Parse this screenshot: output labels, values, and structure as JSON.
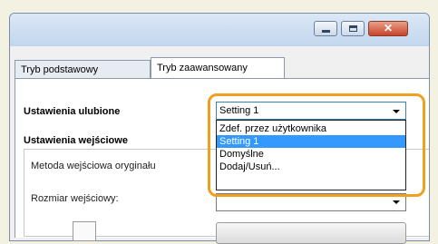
{
  "window": {
    "tabs": [
      {
        "label": "Tryb podstawowy",
        "active": false
      },
      {
        "label": "Tryb zaawansowany",
        "active": true
      }
    ]
  },
  "favorites": {
    "label": "Ustawienia ulubione",
    "selected": "Setting 1",
    "options": [
      "Zdef. przez użytkownika",
      "Setting 1",
      "Domyślne",
      "Dodaj/Usuń..."
    ],
    "highlighted_index": 1
  },
  "input_settings": {
    "label": "Ustawienia wejściowe",
    "method_label": "Metoda wejściowa oryginału",
    "size_label": "Rozmiar wejściowy:"
  },
  "colors": {
    "highlight_border": "#f0a020",
    "selection": "#3399ff"
  }
}
